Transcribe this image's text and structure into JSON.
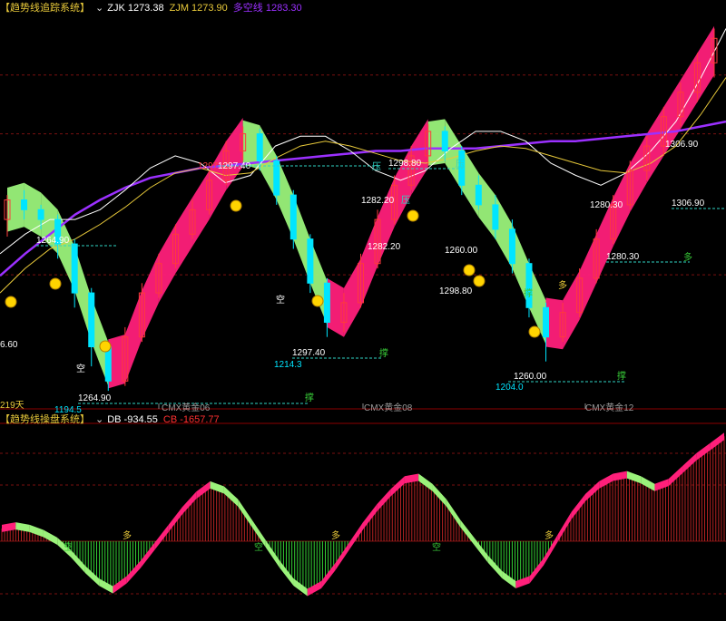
{
  "top_indicator": {
    "title": "【趋势线追踪系统】",
    "dropdown_icon": "chevron-down-icon",
    "zjk": "ZJK 1273.38",
    "zjm": "ZJM 1273.90",
    "duokong": "多空线 1283.30",
    "colors": {
      "title": "#e8c93a",
      "zjk": "#ffffff",
      "zjm": "#e8c93a",
      "duokong": "#9b30ff"
    }
  },
  "bottom_indicator": {
    "title": "【趋势线操盘系统】",
    "dropdown_icon": "chevron-down-icon",
    "db": "DB -934.55",
    "cb": "CB -1657.77",
    "colors": {
      "title": "#e8c93a",
      "db": "#ffffff",
      "cb": "#ff3030"
    }
  },
  "chart_data": [
    {
      "type": "candlestick",
      "instrument_labels": [
        "CMX黄金06",
        "CMX黄金08",
        "CMX黄金12"
      ],
      "period_label": "219天",
      "price_labels": [
        "1297.40",
        "1297.40",
        "1264.90",
        "1264.90",
        "1194.5",
        "1214.3",
        "1297.40",
        "1298.80",
        "1282.20",
        "1282.20",
        "1260.00",
        "1298.80",
        "1280.30",
        "1280.30",
        "1306.90",
        "1306.90",
        "1260.00",
        "1204.0",
        "6.60"
      ],
      "signal_labels": [
        "压",
        "压",
        "压",
        "撑",
        "撑",
        "撑",
        "撑",
        "空",
        "空",
        "多",
        "多"
      ],
      "series": [
        {
          "name": "多空线",
          "color": "#9b30ff",
          "values": [
            1239,
            1248,
            1256,
            1264,
            1270,
            1275,
            1279,
            1281,
            1283,
            1284,
            1285,
            1286,
            1287,
            1288,
            1289,
            1290,
            1290,
            1291,
            1291,
            1291,
            1292,
            1293,
            1294,
            1294,
            1295,
            1296,
            1297,
            1298,
            1300,
            1302
          ]
        },
        {
          "name": "ZJK",
          "color": "#ffffff",
          "values": [
            1248,
            1256,
            1262,
            1262,
            1266,
            1274,
            1283,
            1288,
            1285,
            1277,
            1280,
            1292,
            1296,
            1296,
            1290,
            1282,
            1278,
            1282,
            1291,
            1298,
            1298,
            1294,
            1285,
            1280,
            1276,
            1281,
            1290,
            1302,
            1320,
            1340
          ]
        },
        {
          "name": "ZJM",
          "color": "#e8c93a",
          "values": [
            1232,
            1242,
            1250,
            1254,
            1260,
            1267,
            1275,
            1281,
            1283,
            1280,
            1281,
            1287,
            1292,
            1294,
            1292,
            1289,
            1286,
            1285,
            1287,
            1290,
            1292,
            1291,
            1288,
            1285,
            1282,
            1281,
            1285,
            1292,
            1305,
            1320
          ]
        }
      ],
      "candles": [
        [
          1262,
          1270,
          1255,
          1272
        ],
        [
          1270,
          1266,
          1262,
          1274
        ],
        [
          1266,
          1262,
          1258,
          1268
        ],
        [
          1262,
          1252,
          1246,
          1264
        ],
        [
          1252,
          1232,
          1226,
          1254
        ],
        [
          1232,
          1210,
          1202,
          1234
        ],
        [
          1210,
          1196,
          1192,
          1212
        ],
        [
          1196,
          1214,
          1194,
          1218
        ],
        [
          1214,
          1232,
          1212,
          1236
        ],
        [
          1232,
          1244,
          1230,
          1248
        ],
        [
          1244,
          1256,
          1242,
          1260
        ],
        [
          1256,
          1266,
          1254,
          1270
        ],
        [
          1266,
          1278,
          1264,
          1282
        ],
        [
          1278,
          1290,
          1276,
          1294
        ],
        [
          1290,
          1297,
          1286,
          1300
        ],
        [
          1297,
          1286,
          1282,
          1299
        ],
        [
          1286,
          1272,
          1268,
          1288
        ],
        [
          1272,
          1254,
          1250,
          1274
        ],
        [
          1254,
          1236,
          1232,
          1256
        ],
        [
          1236,
          1220,
          1214,
          1238
        ],
        [
          1220,
          1228,
          1216,
          1232
        ],
        [
          1228,
          1244,
          1226,
          1248
        ],
        [
          1244,
          1262,
          1242,
          1266
        ],
        [
          1262,
          1276,
          1260,
          1280
        ],
        [
          1276,
          1288,
          1274,
          1292
        ],
        [
          1288,
          1298,
          1284,
          1301
        ],
        [
          1298,
          1290,
          1286,
          1300
        ],
        [
          1290,
          1276,
          1272,
          1292
        ],
        [
          1276,
          1268,
          1266,
          1280
        ],
        [
          1268,
          1258,
          1254,
          1272
        ],
        [
          1258,
          1244,
          1240,
          1262
        ],
        [
          1244,
          1226,
          1222,
          1246
        ],
        [
          1226,
          1214,
          1204,
          1228
        ],
        [
          1214,
          1224,
          1212,
          1228
        ],
        [
          1224,
          1238,
          1222,
          1242
        ],
        [
          1238,
          1254,
          1236,
          1258
        ],
        [
          1254,
          1268,
          1252,
          1272
        ],
        [
          1268,
          1282,
          1266,
          1286
        ],
        [
          1282,
          1292,
          1278,
          1296
        ],
        [
          1292,
          1304,
          1288,
          1308
        ],
        [
          1304,
          1314,
          1300,
          1318
        ],
        [
          1314,
          1326,
          1310,
          1330
        ],
        [
          1326,
          1336,
          1320,
          1340
        ]
      ]
    },
    {
      "type": "bar",
      "name": "MACD-style oscillator",
      "zero_line": 0,
      "values": [
        10,
        12,
        10,
        6,
        0,
        -10,
        -22,
        -32,
        -38,
        -30,
        -18,
        -4,
        10,
        24,
        36,
        44,
        40,
        30,
        14,
        -2,
        -18,
        -32,
        -40,
        -34,
        -20,
        -4,
        12,
        26,
        38,
        48,
        50,
        42,
        30,
        14,
        0,
        -14,
        -26,
        -34,
        -30,
        -16,
        2,
        20,
        34,
        44,
        50,
        52,
        48,
        42,
        46,
        56,
        66,
        74,
        82
      ]
    }
  ]
}
